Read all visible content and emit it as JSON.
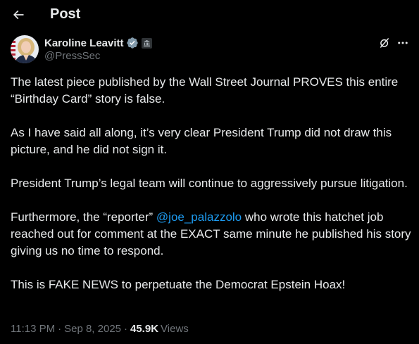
{
  "header": {
    "title": "Post",
    "back_icon": "arrow-left-icon"
  },
  "author": {
    "display_name": "Karoline Leavitt",
    "handle": "@PressSec",
    "verified_icon": "verified-badge-icon",
    "affiliation_icon": "government-affiliation-icon",
    "verified_color": "#829aab"
  },
  "actions": {
    "grok_icon": "grok-icon",
    "more_icon": "more-icon"
  },
  "post": {
    "p1": "The latest piece published by the Wall Street Journal PROVES this entire “Birthday Card” story is false.",
    "p2": "As I have said all along, it’s very clear President Trump did not draw this picture, and he did not sign it.",
    "p3": "President Trump’s legal team will continue to aggressively pursue litigation.",
    "p4_before": "Furthermore, the “reporter” ",
    "p4_mention": "@joe_palazzolo",
    "p4_after": " who wrote this hatchet job reached out for comment at the EXACT same minute he published his story giving us no time to respond.",
    "p5": "This is FAKE NEWS to perpetuate the Democrat Epstein Hoax!"
  },
  "meta": {
    "time": "11:13 PM",
    "separator": "·",
    "date": "Sep 8, 2025",
    "views_count": "45.9K",
    "views_label": "Views"
  },
  "colors": {
    "background": "#000000",
    "text": "#e7e9ea",
    "secondary_text": "#71767b",
    "link": "#1d9bf0"
  }
}
